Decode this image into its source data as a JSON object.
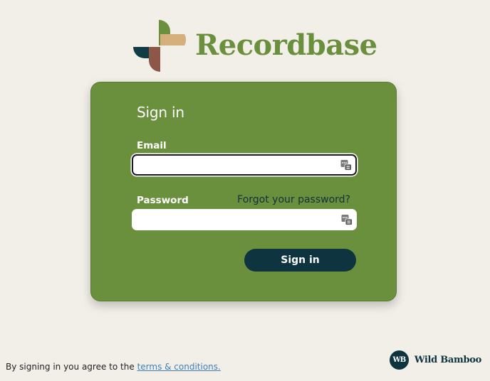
{
  "app": {
    "name": "Recordbase",
    "brand_color": "#6a8f3d"
  },
  "form": {
    "title": "Sign in",
    "email": {
      "label": "Email",
      "value": "",
      "placeholder": "",
      "icon": "password-manager-icon"
    },
    "password": {
      "label": "Password",
      "value": "",
      "placeholder": "",
      "icon": "password-manager-icon"
    },
    "forgot_link": "Forgot your password?",
    "submit_label": "Sign in",
    "submit_color": "#0e3440"
  },
  "footer": {
    "agreement_text": "By signing in you agree to the",
    "terms_link": "terms & conditions.",
    "vendor_monogram": "WB",
    "vendor_name": "Wild Bamboo"
  }
}
